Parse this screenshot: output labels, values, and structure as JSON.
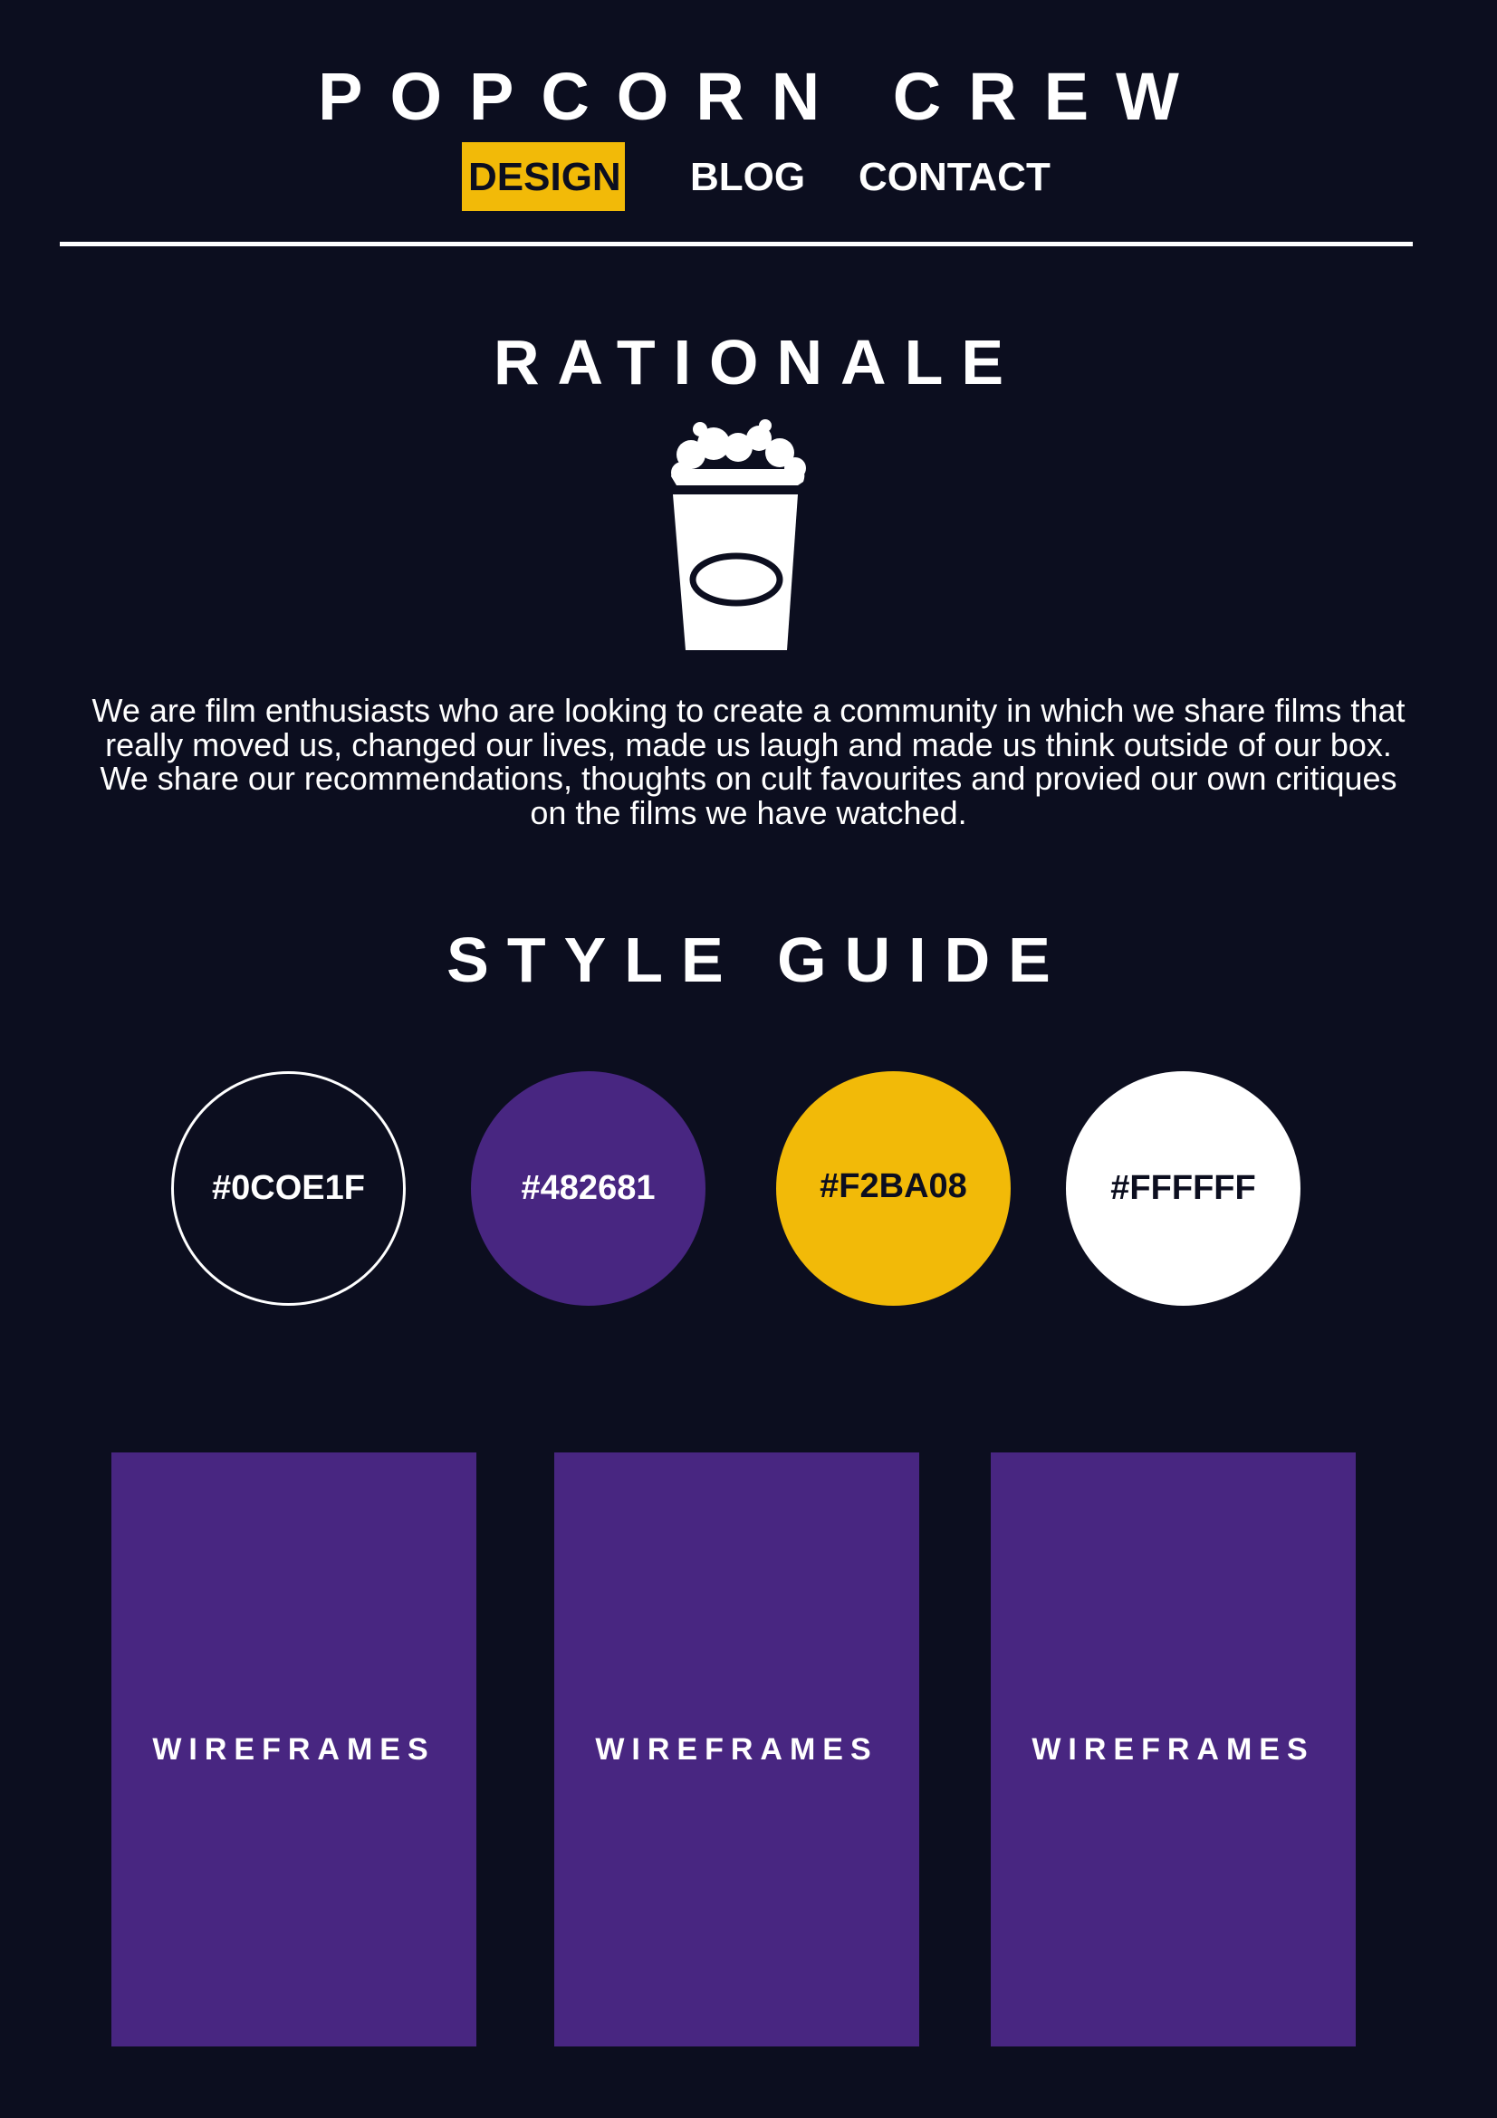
{
  "header": {
    "site_title": "POPCORN CREW",
    "nav": [
      {
        "label": "DESIGN",
        "active": true
      },
      {
        "label": "BLOG",
        "active": false
      },
      {
        "label": "CONTACT",
        "active": false
      }
    ]
  },
  "rationale": {
    "title": "RATIONALE",
    "icon": "popcorn-cup-icon",
    "body": "We are film enthusiasts who are looking to create a community in which we share films that really moved us, changed our lives, made us laugh and made us think outside of our box. We share our recommendations, thoughts on cult favourites and provied our own critiques on the films we have watched."
  },
  "style_guide": {
    "title": "STYLE GUIDE",
    "swatches": [
      {
        "label": "#0COE1F",
        "color": "#0C0E1F"
      },
      {
        "label": "#482681",
        "color": "#482681"
      },
      {
        "label": "#F2BA08",
        "color": "#F2BA08"
      },
      {
        "label": "#FFFFFF",
        "color": "#FFFFFF"
      }
    ]
  },
  "wireframes": [
    {
      "label": "WIREFRAMES"
    },
    {
      "label": "WIREFRAMES"
    },
    {
      "label": "WIREFRAMES"
    }
  ],
  "colors": {
    "background": "#0C0E1F",
    "purple": "#482681",
    "yellow": "#F2BA08",
    "white": "#FFFFFF"
  }
}
